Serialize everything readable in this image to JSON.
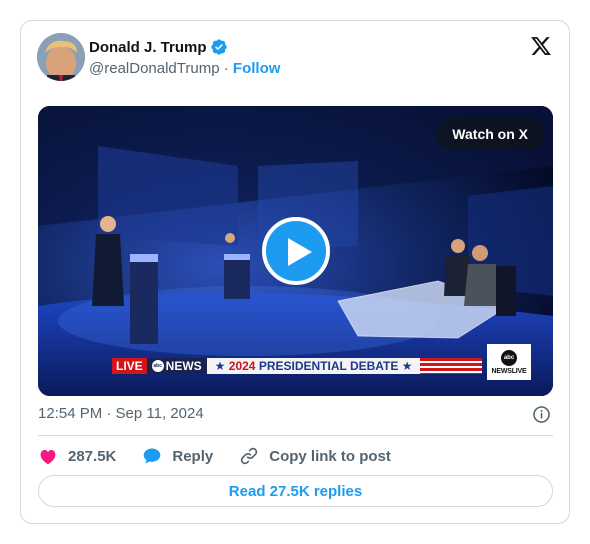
{
  "author": {
    "name": "Donald J. Trump",
    "handle": "@realDonaldTrump",
    "separator": "·",
    "follow_label": "Follow"
  },
  "media": {
    "watch_label": "Watch on X",
    "lower_third": {
      "live": "LIVE",
      "network": "NEWS",
      "year": "2024",
      "title": "PRESIDENTIAL DEBATE"
    },
    "bug": {
      "logo": "abc",
      "text": "NEWSLIVE"
    }
  },
  "timestamp": "12:54 PM · Sep 11, 2024",
  "actions": {
    "likes": "287.5K",
    "reply_label": "Reply",
    "copy_label": "Copy link to post"
  },
  "read_replies_label": "Read 27.5K replies",
  "colors": {
    "accent": "#1d9bf0",
    "heart": "#f91880",
    "muted": "#536471"
  },
  "icons": [
    "verified-badge-icon",
    "x-logo-icon",
    "play-icon",
    "info-icon",
    "heart-icon",
    "reply-bubble-icon",
    "link-icon"
  ]
}
